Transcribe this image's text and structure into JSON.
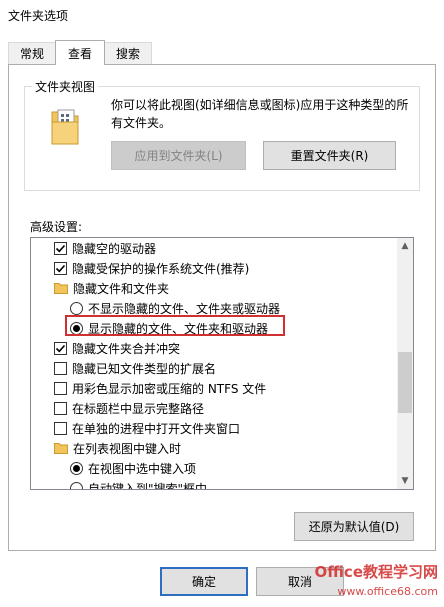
{
  "window": {
    "title": "文件夹选项"
  },
  "tabs": [
    {
      "label": "常规",
      "active": false
    },
    {
      "label": "查看",
      "active": true
    },
    {
      "label": "搜索",
      "active": false
    }
  ],
  "folder_views": {
    "group_label": "文件夹视图",
    "description": "你可以将此视图(如详细信息或图标)应用于这种类型的所有文件夹。",
    "apply_button": "应用到文件夹(L)",
    "reset_button": "重置文件夹(R)"
  },
  "advanced": {
    "label": "高级设置:",
    "items": [
      {
        "type": "checkbox",
        "checked": true,
        "indent": 1,
        "label": "隐藏空的驱动器"
      },
      {
        "type": "checkbox",
        "checked": true,
        "indent": 1,
        "label": "隐藏受保护的操作系统文件(推荐)"
      },
      {
        "type": "folder",
        "indent": 1,
        "label": "隐藏文件和文件夹"
      },
      {
        "type": "radio",
        "checked": false,
        "indent": 2,
        "label": "不显示隐藏的文件、文件夹或驱动器"
      },
      {
        "type": "radio",
        "checked": true,
        "indent": 2,
        "label": "显示隐藏的文件、文件夹和驱动器",
        "highlighted": true
      },
      {
        "type": "checkbox",
        "checked": true,
        "indent": 1,
        "label": "隐藏文件夹合并冲突"
      },
      {
        "type": "checkbox",
        "checked": false,
        "indent": 1,
        "label": "隐藏已知文件类型的扩展名"
      },
      {
        "type": "checkbox",
        "checked": false,
        "indent": 1,
        "label": "用彩色显示加密或压缩的 NTFS 文件"
      },
      {
        "type": "checkbox",
        "checked": false,
        "indent": 1,
        "label": "在标题栏中显示完整路径"
      },
      {
        "type": "checkbox",
        "checked": false,
        "indent": 1,
        "label": "在单独的进程中打开文件夹窗口"
      },
      {
        "type": "folder",
        "indent": 1,
        "label": "在列表视图中键入时"
      },
      {
        "type": "radio",
        "checked": true,
        "indent": 2,
        "label": "在视图中选中键入项"
      },
      {
        "type": "radio",
        "checked": false,
        "indent": 2,
        "label": "自动键入到\"搜索\"框中"
      }
    ],
    "scroll_position": 0.62,
    "scroll_thumb_fraction": 0.28,
    "restore_button": "还原为默认值(D)"
  },
  "footer": {
    "ok_button": "确定",
    "cancel_button": "取消"
  },
  "watermark": {
    "line1": "Office教程学习网",
    "line2": "www.office68.com"
  },
  "colors": {
    "highlight_border": "#d03030",
    "default_button_border": "#2d6fbf",
    "folder_yellow": "#f2c55c"
  }
}
